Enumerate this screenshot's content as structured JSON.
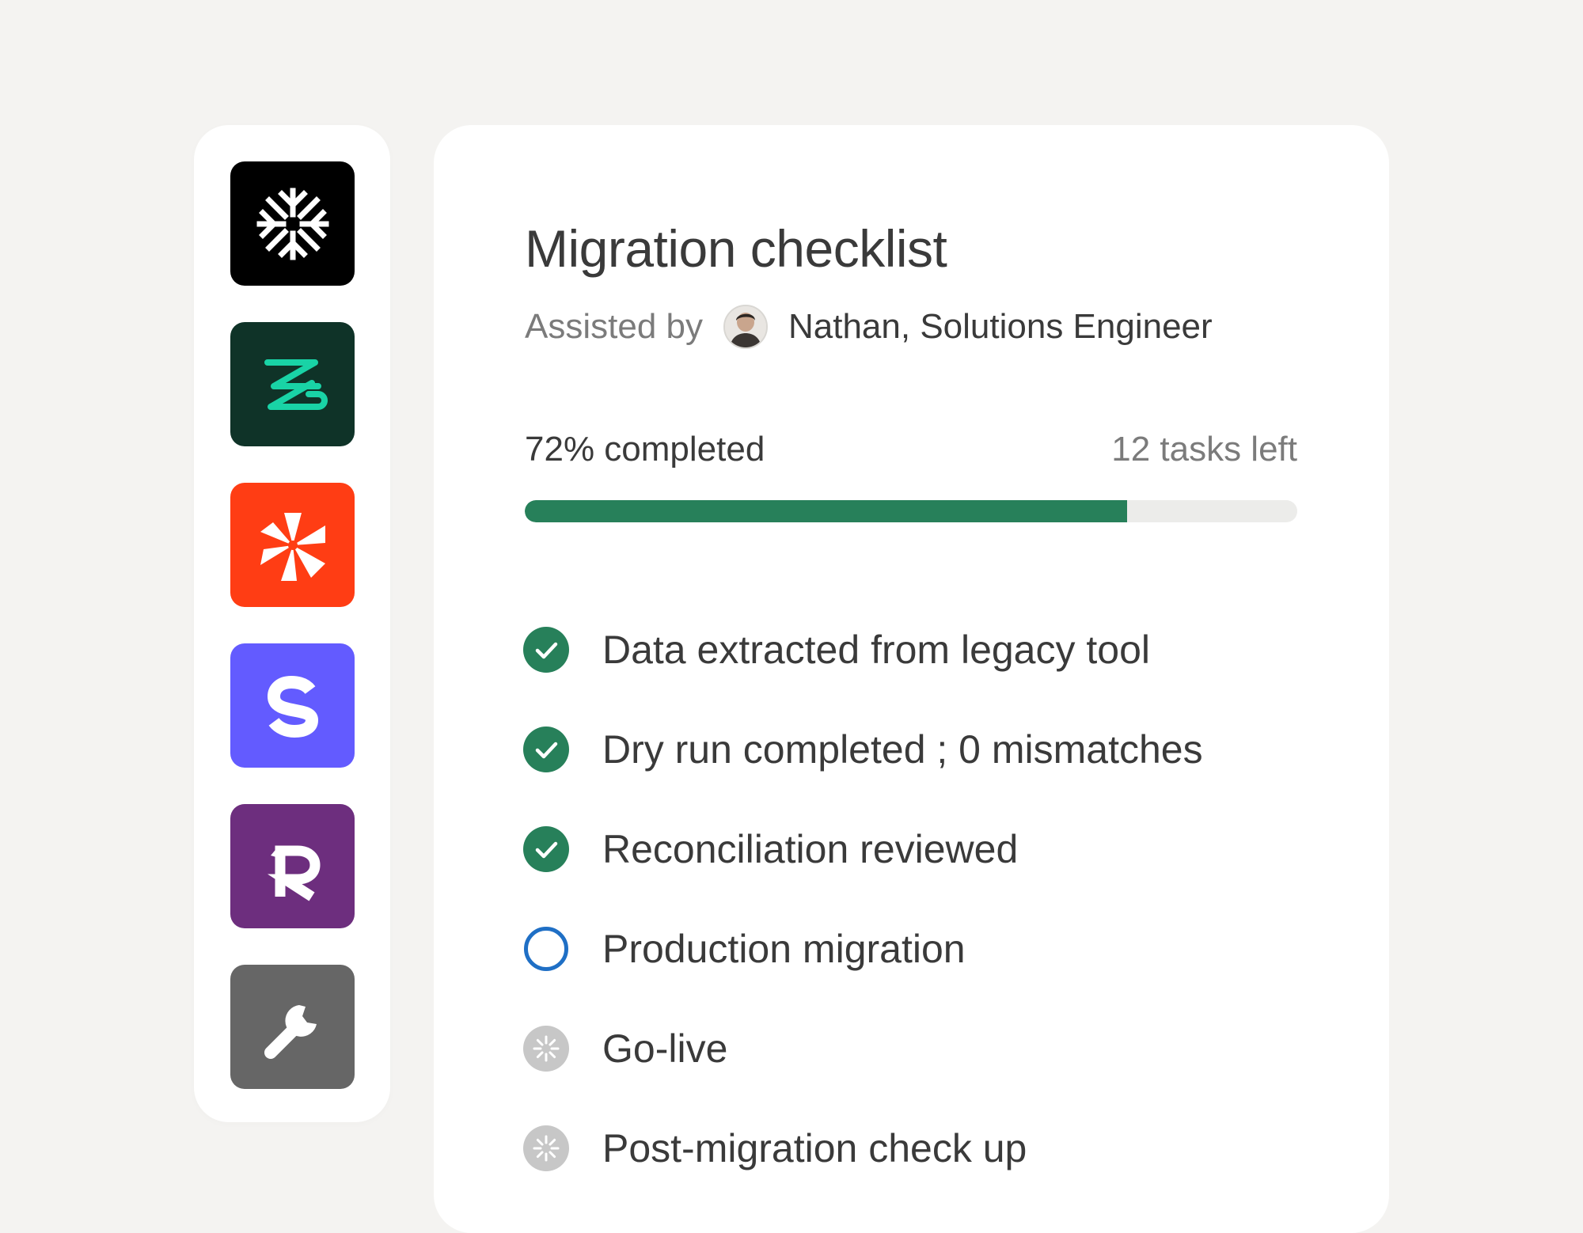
{
  "apps": [
    {
      "name": "snowflake-app",
      "icon": "snowflake-icon",
      "bg": "#000000"
    },
    {
      "name": "zigzag-app",
      "icon": "zigzag-z-icon",
      "bg": "#0f3328"
    },
    {
      "name": "pinwheel-app",
      "icon": "pinwheel-icon",
      "bg": "#ff3d14"
    },
    {
      "name": "s-app",
      "icon": "letter-s-icon",
      "bg": "#635bff"
    },
    {
      "name": "r-app",
      "icon": "letter-r-icon",
      "bg": "#6d2e7e"
    },
    {
      "name": "tools-app",
      "icon": "wrench-icon",
      "bg": "#666666"
    }
  ],
  "checklist": {
    "title": "Migration checklist",
    "assisted_label": "Assisted by",
    "assistant_name": "Nathan, Solutions Engineer",
    "progress_label": "72% completed",
    "progress_value": 0.78,
    "tasks_left": "12 tasks left",
    "colors": {
      "done": "#27805a",
      "in_progress": "#1f6fc5",
      "pending": "#c7c7c7",
      "track": "#ececea"
    },
    "items": [
      {
        "label": "Data extracted from legacy tool",
        "status": "done"
      },
      {
        "label": "Dry run completed ; 0 mismatches",
        "status": "done"
      },
      {
        "label": "Reconciliation reviewed",
        "status": "done"
      },
      {
        "label": "Production migration",
        "status": "in_progress"
      },
      {
        "label": "Go-live",
        "status": "pending"
      },
      {
        "label": "Post-migration check up",
        "status": "pending"
      }
    ]
  }
}
